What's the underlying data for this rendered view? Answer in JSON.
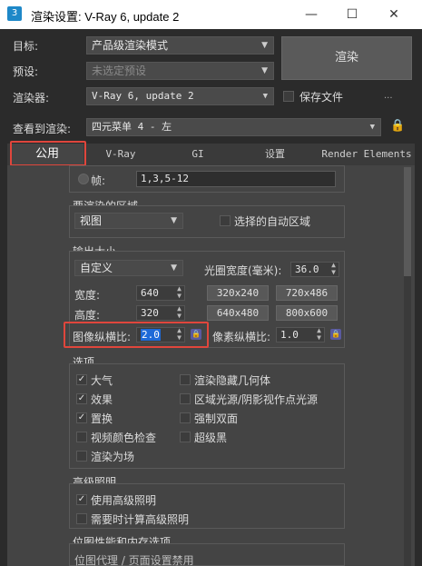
{
  "window": {
    "title": "渲染设置: V-Ray 6, update 2",
    "app_icon": "3",
    "minimize": "—",
    "maximize": "☐",
    "close": "✕"
  },
  "header": {
    "target_label": "目标:",
    "target_value": "产品级渲染模式",
    "preset_label": "预设:",
    "preset_placeholder": "未选定预设",
    "renderer_label": "渲染器:",
    "renderer_value": "V-Ray 6, update 2",
    "save_file_label": "保存文件",
    "render_button": "渲染",
    "more": "...",
    "view_label": "查看到渲染:",
    "view_value": "四元菜单 4 - 左"
  },
  "tabs": [
    {
      "label": "公用",
      "active": true
    },
    {
      "label": "V-Ray"
    },
    {
      "label": "GI"
    },
    {
      "label": "设置"
    },
    {
      "label": "Render Elements"
    }
  ],
  "frames": {
    "label": "帧:",
    "value": "1,3,5-12"
  },
  "area": {
    "title": "要渲染的区域",
    "mode": "视图",
    "auto_region_label": "选择的自动区域"
  },
  "output": {
    "title": "输出大小",
    "preset": "自定义",
    "aperture_label": "光圈宽度(毫米):",
    "aperture_value": "36.0",
    "width_label": "宽度:",
    "width_value": "640",
    "height_label": "高度:",
    "height_value": "320",
    "sizes": [
      "320x240",
      "720x486",
      "640x480",
      "800x600"
    ],
    "image_aspect_label": "图像纵横比:",
    "image_aspect_value": "2.0",
    "pixel_aspect_label": "像素纵横比:",
    "pixel_aspect_value": "1.0"
  },
  "options": {
    "title": "选项",
    "left": [
      {
        "label": "大气",
        "checked": true
      },
      {
        "label": "效果",
        "checked": true
      },
      {
        "label": "置换",
        "checked": true
      },
      {
        "label": "视频颜色检查",
        "checked": false
      },
      {
        "label": "渲染为场",
        "checked": false
      }
    ],
    "right": [
      {
        "label": "渲染隐藏几何体",
        "checked": false
      },
      {
        "label": "区域光源/阴影视作点光源",
        "checked": false
      },
      {
        "label": "强制双面",
        "checked": false
      },
      {
        "label": "超级黑",
        "checked": false
      }
    ]
  },
  "advanced_lighting": {
    "title": "高级照明",
    "items": [
      {
        "label": "使用高级照明",
        "checked": true
      },
      {
        "label": "需要时计算高级照明",
        "checked": false
      }
    ]
  },
  "bitmap": {
    "title": "位图性能和内存选项",
    "partial": "位图代理 / 页面设置禁用"
  },
  "colors": {
    "highlight": "#e0463c",
    "lock": "#5a5aa0"
  }
}
